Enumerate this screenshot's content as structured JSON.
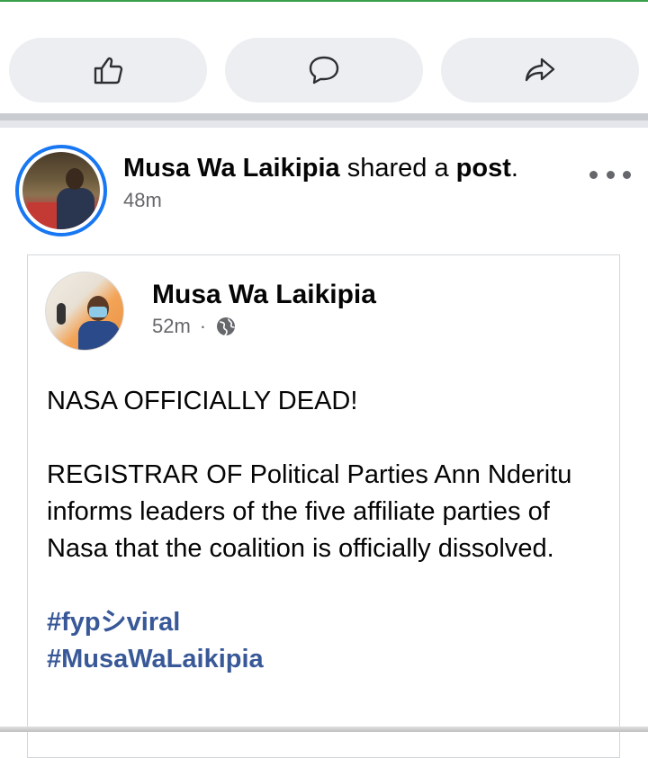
{
  "actions": {
    "like": "thumbs-up-icon",
    "comment": "comment-icon",
    "share": "share-icon"
  },
  "post": {
    "author": "Musa Wa Laikipia",
    "action_text": " shared a ",
    "object_text": "post",
    "period": ".",
    "time": "48m"
  },
  "shared": {
    "author": "Musa Wa Laikipia",
    "time": "52m",
    "separator": "·",
    "privacy_icon": "globe-icon",
    "headline": "NASA OFFICIALLY DEAD!",
    "body": "REGISTRAR OF Political Parties Ann Nderitu informs leaders of the five affiliate parties of Nasa that the coalition is officially dissolved.",
    "hashtags": [
      "#fypシviral",
      "#MusaWaLaikipia"
    ]
  },
  "colors": {
    "accent": "#1877f2",
    "hashtag": "#385898",
    "secondary_text": "#65676b"
  }
}
